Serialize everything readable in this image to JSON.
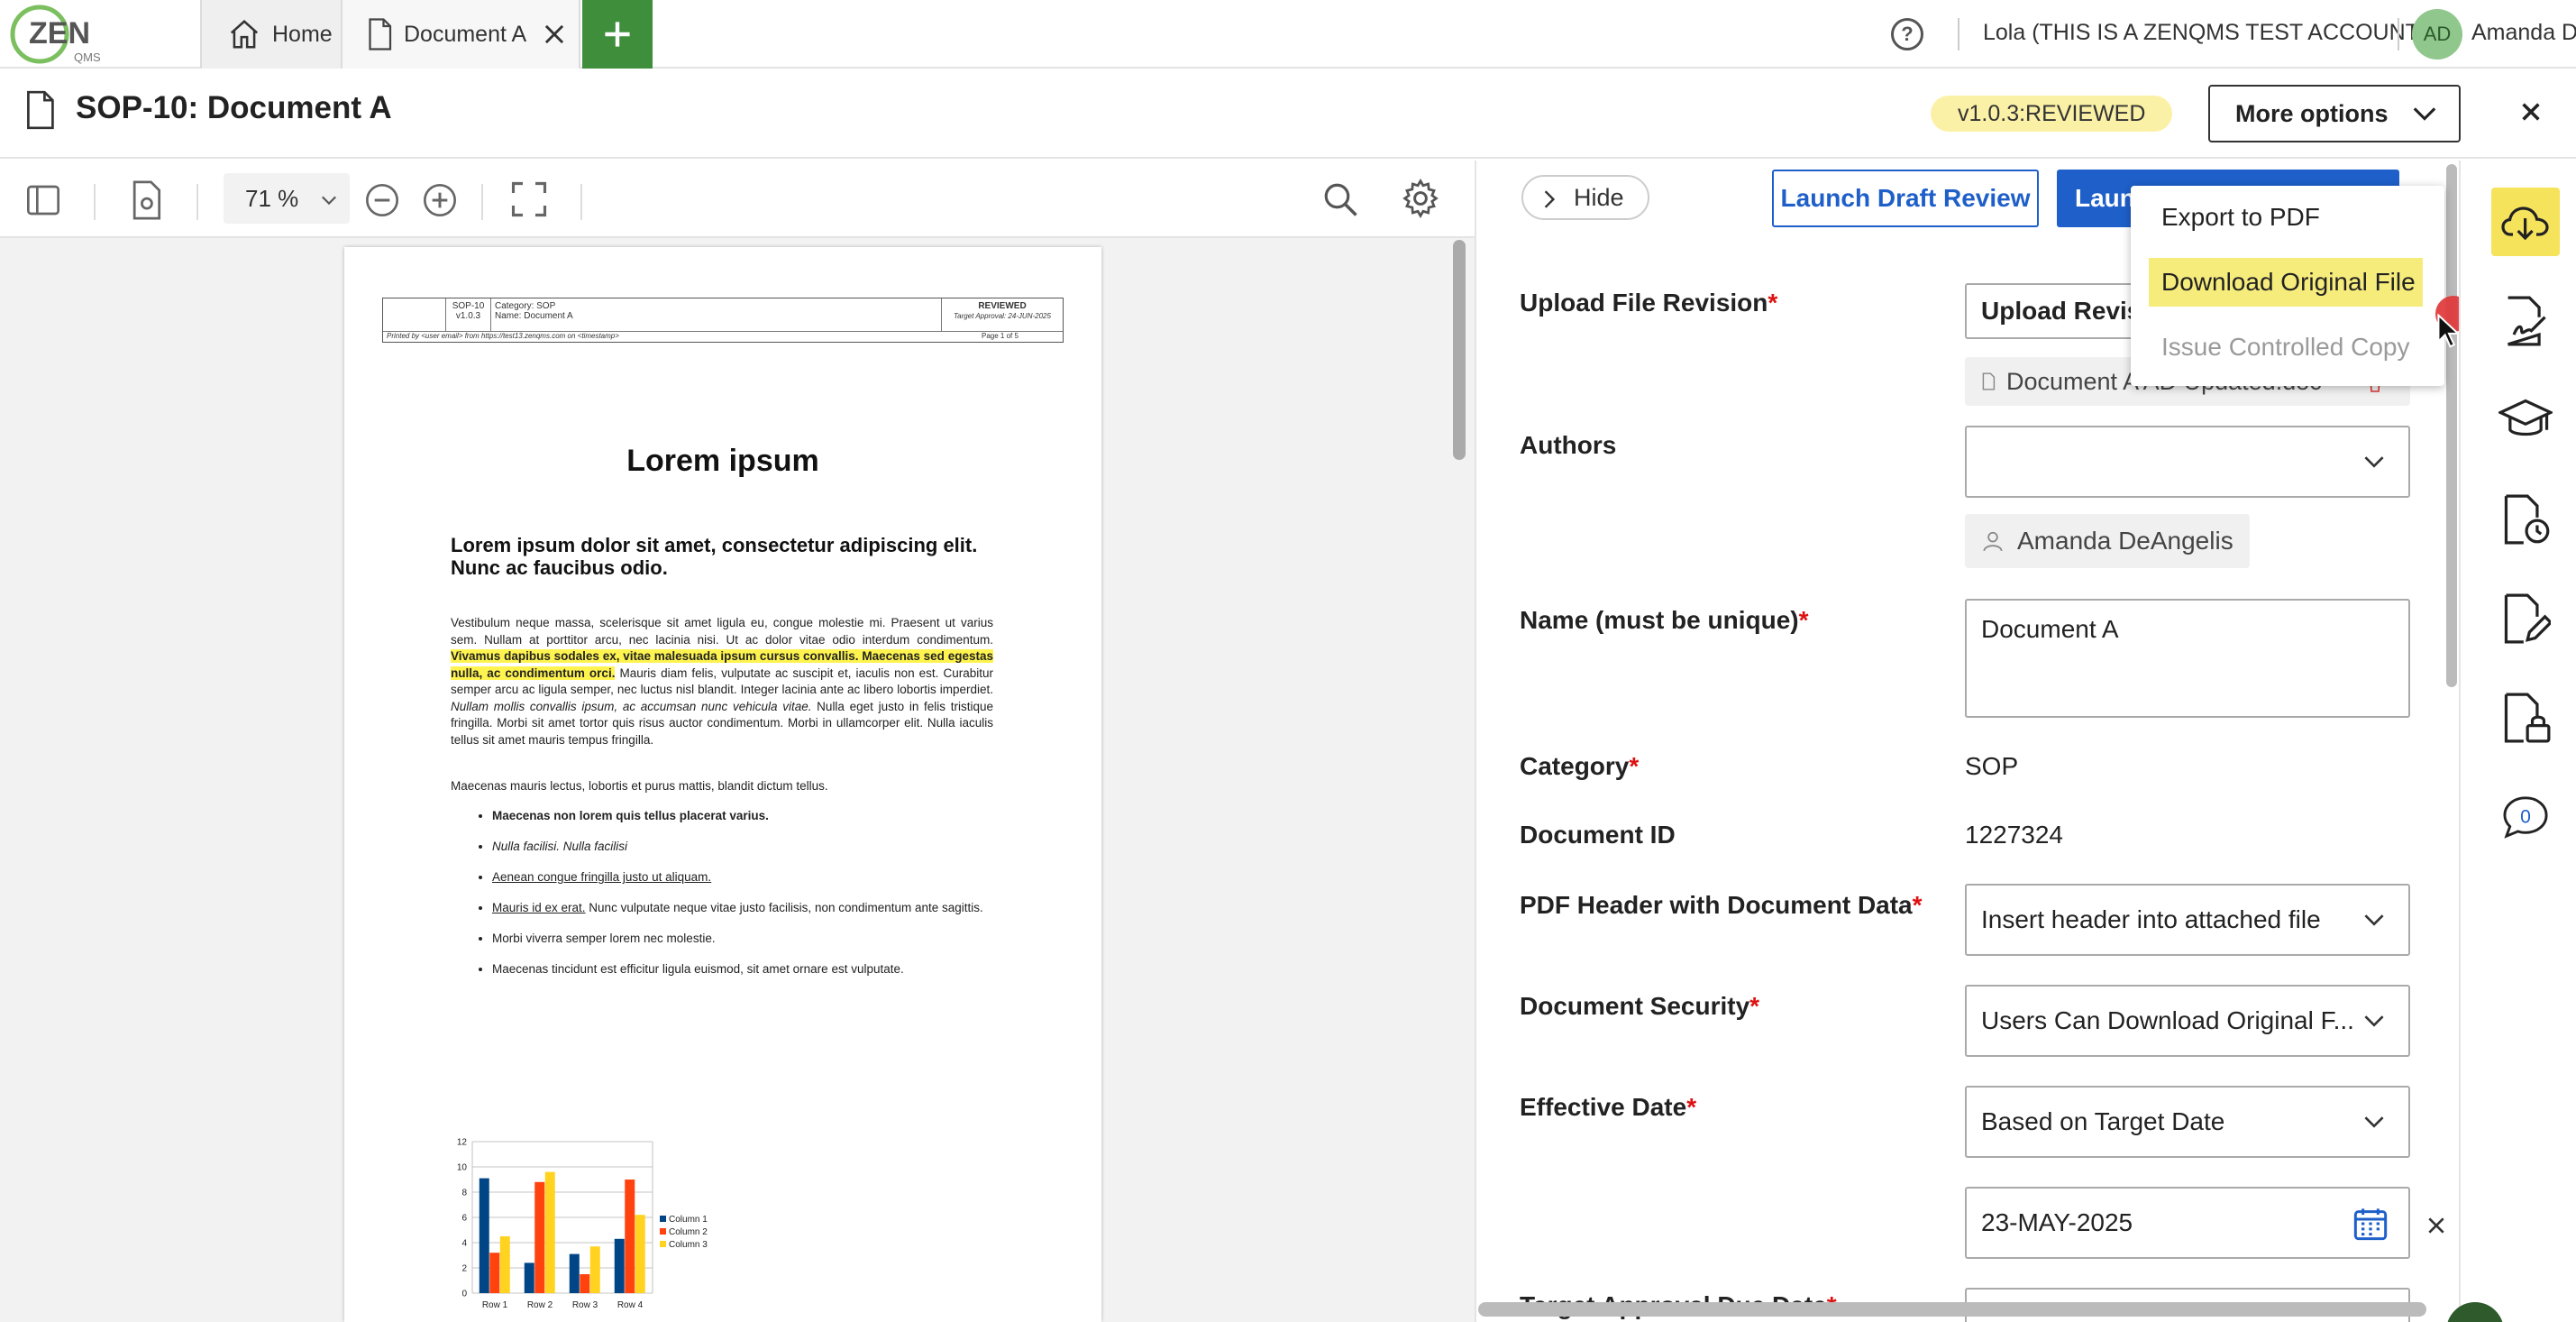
{
  "nav": {
    "logo_text": "ZEN",
    "logo_sub": "QMS",
    "tabs": [
      {
        "label": "Home",
        "icon": "home-icon"
      },
      {
        "label": "Document A",
        "icon": "document-icon"
      }
    ],
    "account_label": "Lola (THIS IS A ZENQMS TEST ACCOUNT)",
    "avatar_initials": "AD",
    "user_name": "Amanda D"
  },
  "titlebar": {
    "title": "SOP-10: Document A",
    "version": "v1.0.3:REVIEWED",
    "more_options": "More options"
  },
  "viewer": {
    "zoom": "71 %"
  },
  "document": {
    "header": {
      "code": "SOP-10",
      "version": "v1.0.3",
      "category": "Category: SOP",
      "name": "Name: Document A",
      "status": "REVIEWED",
      "target": "Target Approval: 24-JUN-2025",
      "printed": "Printed by <user email> from https://test13.zenqms.com on <timestamp>",
      "page": "Page 1 of 5"
    },
    "heading": "Lorem ipsum",
    "subheading": "Lorem ipsum dolor sit amet, consectetur adipiscing elit. Nunc ac faucibus odio.",
    "para1_a": "Vestibulum neque massa, scelerisque sit amet ligula eu, congue molestie mi. Praesent ut varius sem. Nullam at porttitor arcu, nec lacinia nisi. Ut ac dolor vitae odio interdum condimentum.",
    "para1_hl": " Vivamus dapibus sodales ex, vitae malesuada ipsum cursus convallis. Maecenas sed egestas nulla, ac condimentum orci.",
    "para1_b": " Mauris diam felis, vulputate ac suscipit et, iaculis non est. Curabitur semper arcu ac ligula semper, nec luctus nisl blandit. Integer lacinia ante ac libero lobortis imperdiet. ",
    "para1_i": "Nullam mollis convallis ipsum, ac accumsan nunc vehicula vitae.",
    "para1_c": " Nulla eget justo in felis tristique fringilla. Morbi sit amet tortor quis risus auctor condimentum. Morbi in ullamcorper elit. Nulla iaculis tellus sit amet mauris tempus fringilla.",
    "para2": "Maecenas mauris lectus, lobortis et purus mattis, blandit dictum tellus.",
    "list": {
      "item1": "Maecenas non lorem quis tellus placerat varius.",
      "item2": "Nulla facilisi. Nulla facilisi",
      "item3": "Aenean congue fringilla justo ut aliquam.",
      "item4_u": "Mauris id ex erat.",
      "item4_rest": " Nunc vulputate neque vitae justo facilisis, non condimentum ante sagittis.",
      "item5": "Morbi viverra semper lorem nec molestie.",
      "item6": "Maecenas tincidunt est efficitur ligula euismod, sit amet ornare est vulputate."
    }
  },
  "chart_data": {
    "type": "bar",
    "categories": [
      "Row 1",
      "Row 2",
      "Row 3",
      "Row 4"
    ],
    "series": [
      {
        "name": "Column 1",
        "values": [
          9.1,
          2.4,
          3.1,
          4.3
        ],
        "color": "#004586"
      },
      {
        "name": "Column 2",
        "values": [
          3.2,
          8.8,
          1.5,
          9.0
        ],
        "color": "#ff420e"
      },
      {
        "name": "Column 3",
        "values": [
          4.5,
          9.6,
          3.7,
          6.2
        ],
        "color": "#ffd320"
      }
    ],
    "ylim": [
      0,
      12
    ],
    "yticks": [
      "0",
      "2",
      "4",
      "6",
      "8",
      "10",
      "12"
    ],
    "grid": true,
    "legend": "right"
  },
  "panel": {
    "hide": "Hide",
    "launch_draft_review": "Launch Draft Review",
    "launch_visible": "Launc",
    "fields": {
      "upload_label": "Upload File Revision",
      "upload_button": "Upload Revisi",
      "upload_file": "Document A AD Updated.doc",
      "authors_label": "Authors",
      "author_chip": "Amanda DeAngelis",
      "name_label": "Name (must be unique)",
      "name_value": "Document A",
      "category_label": "Category",
      "category_value": "SOP",
      "docid_label": "Document ID",
      "docid_value": "1227324",
      "pdfheader_label": "PDF Header with Document Data",
      "pdfheader_value": "Insert header into attached file",
      "security_label": "Document Security",
      "security_value": "Users Can Download Original F...",
      "effective_label": "Effective Date",
      "effective_value": "Based on Target Date",
      "date_value": "23-MAY-2025",
      "next_label": "Target Approval Due Date"
    }
  },
  "menu": {
    "export_pdf": "Export to PDF",
    "download_original": "Download Original File",
    "issue_controlled": "Issue Controlled Copy"
  },
  "rail": {
    "comments_count": "0"
  },
  "colors": {
    "brand_green": "#3e8e3c",
    "primary_blue": "#1e5fc9",
    "highlight_yellow": "#f6ec7c",
    "badge_yellow": "#fbf1a6",
    "required_red": "#d11"
  }
}
